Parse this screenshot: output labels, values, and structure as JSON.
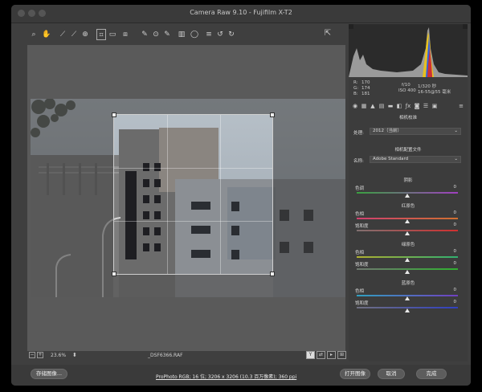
{
  "window": {
    "title": "Camera Raw 9.10 - Fujifilm X-T2"
  },
  "toolbar": {
    "tools": [
      {
        "icon": "zoom-icon",
        "glyph": "⌕",
        "active": false
      },
      {
        "icon": "hand-icon",
        "glyph": "✋",
        "active": false
      },
      {
        "icon": "white-balance-icon",
        "glyph": "⟋",
        "active": false
      },
      {
        "icon": "color-sampler-icon",
        "glyph": "⟋",
        "active": false
      },
      {
        "icon": "targeted-adjustment-icon",
        "glyph": "⊕",
        "active": false
      },
      {
        "icon": "crop-icon",
        "glyph": "⌗",
        "active": true
      },
      {
        "icon": "straighten-icon",
        "glyph": "▭",
        "active": false
      },
      {
        "icon": "transform-icon",
        "glyph": "⧈",
        "active": false
      },
      {
        "icon": "spot-removal-icon",
        "glyph": "✎",
        "active": false
      },
      {
        "icon": "red-eye-icon",
        "glyph": "⊙",
        "active": false
      },
      {
        "icon": "adjustment-brush-icon",
        "glyph": "✎",
        "active": false
      },
      {
        "icon": "graduated-filter-icon",
        "glyph": "▥",
        "active": false
      },
      {
        "icon": "radial-filter-icon",
        "glyph": "◯",
        "active": false
      },
      {
        "icon": "preferences-icon",
        "glyph": "≡",
        "active": false
      },
      {
        "icon": "rotate-left-icon",
        "glyph": "↺",
        "active": false
      },
      {
        "icon": "rotate-right-icon",
        "glyph": "↻",
        "active": false
      }
    ]
  },
  "status": {
    "zoom": "23.6%",
    "filename": "_DSF6366.RAF"
  },
  "readout": {
    "r_label": "R:",
    "r_val": "170",
    "g_label": "G:",
    "g_val": "174",
    "b_label": "B:",
    "b_val": "181",
    "aperture": "f/10",
    "shutter": "1/320 秒",
    "iso": "ISO 400",
    "lens": "16-55@55 毫米"
  },
  "panel": {
    "title": "相机校准",
    "process_label": "处理:",
    "process_value": "2012（当前）",
    "profile_section": "相机配置文件",
    "name_label": "名称:",
    "name_value": "Adobe Standard",
    "shadows_title": "阴影",
    "red_title": "红原色",
    "green_title": "绿原色",
    "blue_title": "蓝原色",
    "tint_label": "色调",
    "hue_label": "色相",
    "sat_label": "饱和度",
    "zero": "0"
  },
  "sliders": [
    {
      "section": "shadows",
      "label": "tint",
      "value": 0
    },
    {
      "section": "red",
      "label": "hue",
      "value": 0
    },
    {
      "section": "red",
      "label": "sat",
      "value": 0
    },
    {
      "section": "green",
      "label": "hue",
      "value": 0
    },
    {
      "section": "green",
      "label": "sat",
      "value": 0
    },
    {
      "section": "blue",
      "label": "hue",
      "value": 0
    },
    {
      "section": "blue",
      "label": "sat",
      "value": 0
    }
  ],
  "bottom": {
    "save_label": "存储图像...",
    "info_link": "ProPhoto RGB; 16 位; 3206 x 3206 (10.3 百万像素); 360 ppi",
    "open_label": "打开图像",
    "cancel_label": "取消",
    "done_label": "完成"
  }
}
